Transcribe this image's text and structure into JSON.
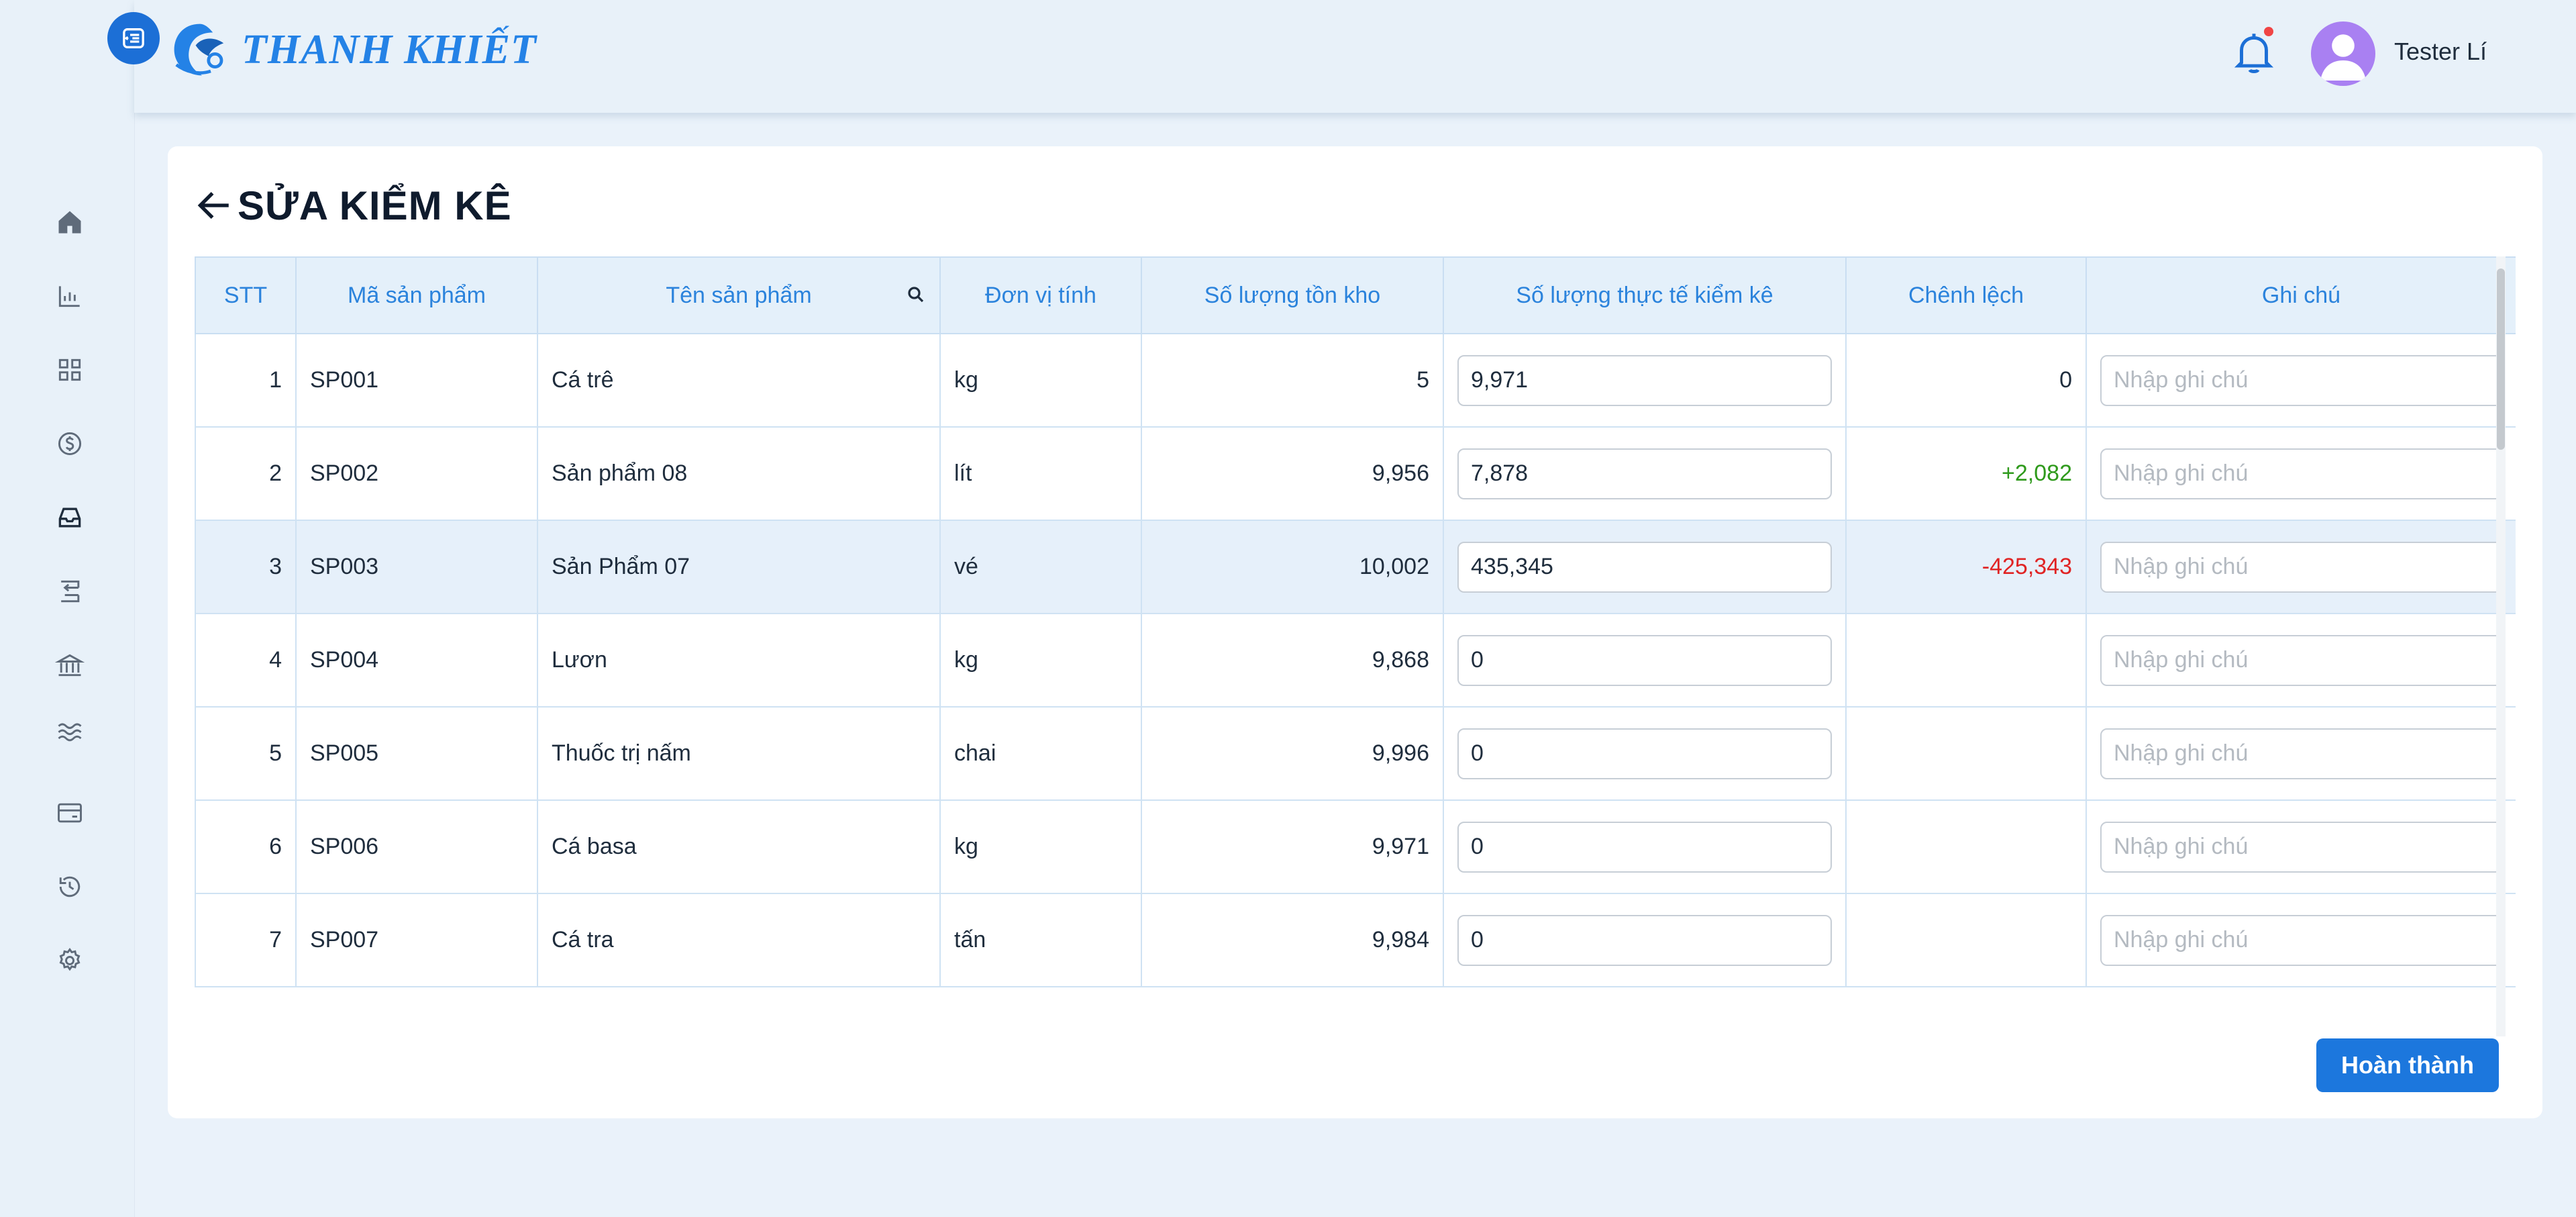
{
  "brand": {
    "name": "THANH KHIẾT",
    "accent": "#1c6fd6"
  },
  "header": {
    "username": "Tester Lí",
    "notification_dot": true
  },
  "sidebar": {
    "items": [
      {
        "icon": "home-icon"
      },
      {
        "icon": "bar-chart-icon"
      },
      {
        "icon": "grid-icon"
      },
      {
        "icon": "dollar-icon"
      },
      {
        "icon": "inbox-icon",
        "active": true
      },
      {
        "icon": "transfer-icon"
      },
      {
        "icon": "bank-icon"
      },
      {
        "icon": "waves-icon"
      },
      {
        "icon": "wallet-icon"
      },
      {
        "icon": "history-icon"
      },
      {
        "icon": "settings-icon"
      }
    ]
  },
  "page": {
    "title": "SỬA KIỂM KÊ",
    "done_label": "Hoàn thành"
  },
  "table": {
    "columns": [
      "STT",
      "Mã sản phẩm",
      "Tên sản phẩm",
      "Đơn vị tính",
      "Số lượng tồn kho",
      "Số lượng thực tế kiểm kê",
      "Chênh lệch",
      "Ghi chú"
    ],
    "note_placeholder": "Nhập ghi chú",
    "rows": [
      {
        "stt": "1",
        "code": "SP001",
        "name": "Cá trê",
        "unit": "kg",
        "stock": "5",
        "actual": "9,971",
        "diff": "0",
        "diff_type": "zero"
      },
      {
        "stt": "2",
        "code": "SP002",
        "name": "Sản phẩm 08",
        "unit": "lít",
        "stock": "9,956",
        "actual": "7,878",
        "diff": "+2,082",
        "diff_type": "pos"
      },
      {
        "stt": "3",
        "code": "SP003",
        "name": "Sản Phẩm 07",
        "unit": "vé",
        "stock": "10,002",
        "actual": "435,345",
        "diff": "-425,343",
        "diff_type": "neg",
        "highlighted": true
      },
      {
        "stt": "4",
        "code": "SP004",
        "name": "Lươn",
        "unit": "kg",
        "stock": "9,868",
        "actual": "0",
        "diff": "",
        "diff_type": "none"
      },
      {
        "stt": "5",
        "code": "SP005",
        "name": "Thuốc trị nấm",
        "unit": "chai",
        "stock": "9,996",
        "actual": "0",
        "diff": "",
        "diff_type": "none"
      },
      {
        "stt": "6",
        "code": "SP006",
        "name": "Cá basa",
        "unit": "kg",
        "stock": "9,971",
        "actual": "0",
        "diff": "",
        "diff_type": "none"
      },
      {
        "stt": "7",
        "code": "SP007",
        "name": "Cá tra",
        "unit": "tấn",
        "stock": "9,984",
        "actual": "0",
        "diff": "",
        "diff_type": "none"
      }
    ]
  }
}
